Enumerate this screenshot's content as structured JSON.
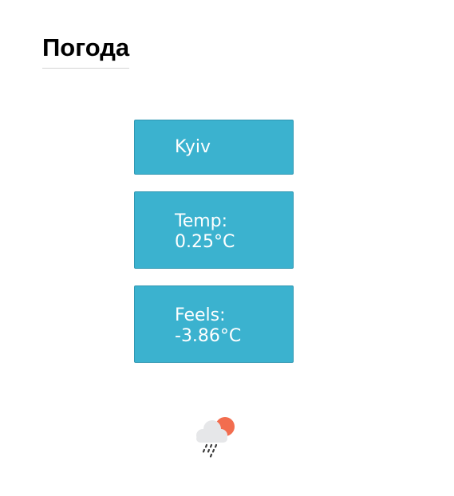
{
  "page": {
    "title": "Погода"
  },
  "weather": {
    "city": "Kyiv",
    "temp_label": "Temp:",
    "temp_value": "0.25°C",
    "feels_label": "Feels:",
    "feels_value": "-3.86°C",
    "icon": "rain-cloud-sun-icon"
  },
  "colors": {
    "card_background": "#3bb2cf",
    "card_text": "#ffffff",
    "sun": "#f26d4f",
    "cloud": "#e6e7e9",
    "rain": "#3d3d3d"
  }
}
